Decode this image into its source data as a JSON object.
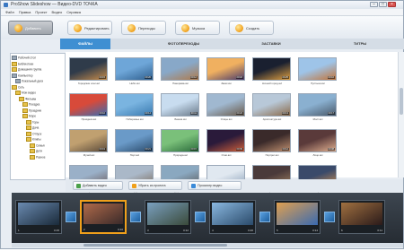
{
  "window": {
    "title": "ProShow Slideshow — Видео-DVD ТОЧКА",
    "min": "–",
    "max": "□",
    "close": "×"
  },
  "menu": [
    "Файл",
    "Правка",
    "Проект",
    "Видео",
    "Справка"
  ],
  "toolbar": [
    {
      "label": "Добавить",
      "active": true
    },
    {
      "label": "Редактировать",
      "active": false
    },
    {
      "label": "Переходы",
      "active": false
    },
    {
      "label": "Музыка",
      "active": false
    },
    {
      "label": "Создать",
      "active": false
    }
  ],
  "tabs": [
    {
      "label": "ФАЙЛЫ",
      "active": true
    },
    {
      "label": "ФОТОПЕРЕХОДЫ",
      "active": false
    },
    {
      "label": "ЗАСТАВКИ",
      "active": false
    },
    {
      "label": "ТИТРЫ",
      "active": false
    }
  ],
  "tree": [
    {
      "label": "Рабочий стол",
      "type": "drive"
    },
    {
      "label": "Библиотеки",
      "type": "folder"
    },
    {
      "label": "Домашняя группа",
      "type": "folder"
    },
    {
      "label": "Компьютер",
      "type": "drive"
    },
    {
      "label": "Локальный диск",
      "type": "drive"
    },
    {
      "label": "Сеть",
      "type": "folder"
    },
    {
      "label": "Мои видео",
      "type": "folder"
    },
    {
      "label": "Фильмы",
      "type": "folder"
    },
    {
      "label": "Поездка",
      "type": "folder"
    },
    {
      "label": "Праздник",
      "type": "folder"
    },
    {
      "label": "Море",
      "type": "folder"
    },
    {
      "label": "Горы",
      "type": "folder"
    },
    {
      "label": "Дача",
      "type": "folder"
    },
    {
      "label": "Отпуск",
      "type": "folder"
    },
    {
      "label": "Клипы",
      "type": "folder"
    },
    {
      "label": "Семья",
      "type": "folder"
    },
    {
      "label": "Дети",
      "type": "folder"
    },
    {
      "label": "Разное",
      "type": "folder"
    }
  ],
  "media": [
    {
      "caption": "Городские огни.avi",
      "dur": "00:15",
      "c1": "#2f3b4a",
      "c2": "#c98d4a"
    },
    {
      "caption": "Небо.avi",
      "dur": "00:20",
      "c1": "#6ea6d8",
      "c2": "#2f5f8e"
    },
    {
      "caption": "Панорама.avi",
      "dur": "00:12",
      "c1": "#88a8c8",
      "c2": "#b07a4a"
    },
    {
      "caption": "Закат.avi",
      "dur": "00:18",
      "c1": "#f0b060",
      "c2": "#4a3a6a"
    },
    {
      "caption": "Ночной город.avi",
      "dur": "00:25",
      "c1": "#1a2030",
      "c2": "#e0a040"
    },
    {
      "caption": "Пустыня.avi",
      "dur": "00:16",
      "c1": "#9ec4e8",
      "c2": "#c2743a"
    },
    {
      "caption": "Праздник.avi",
      "dur": "00:10",
      "c1": "#d84a3a",
      "c2": "#3a6ab0"
    },
    {
      "caption": "Побережье.avi",
      "dur": "00:14",
      "c1": "#7ab4e0",
      "c2": "#3a7ab0"
    },
    {
      "caption": "Башня.avi",
      "dur": "00:11",
      "c1": "#c8dcef",
      "c2": "#6a7a8a"
    },
    {
      "caption": "Улицы.avi",
      "dur": "00:22",
      "c1": "#a0b8d0",
      "c2": "#6a5a4a"
    },
    {
      "caption": "Архитектура.avi",
      "dur": "00:13",
      "c1": "#b8c8d8",
      "c2": "#8a6a4a"
    },
    {
      "caption": "Мост.avi",
      "dur": "00:17",
      "c1": "#8ab0d0",
      "c2": "#4a5a6a"
    },
    {
      "caption": "Музей.avi",
      "dur": "00:19",
      "c1": "#c0a070",
      "c2": "#5a4a3a"
    },
    {
      "caption": "Порт.avi",
      "dur": "00:21",
      "c1": "#6a9ac8",
      "c2": "#2a4a6a"
    },
    {
      "caption": "Природа.avi",
      "dur": "00:15",
      "c1": "#7ac07a",
      "c2": "#2a6a3a"
    },
    {
      "caption": "Огни.avi",
      "dur": "00:09",
      "c1": "#2a1a3a",
      "c2": "#d0603a"
    },
    {
      "caption": "Портрет.avi",
      "dur": "00:12",
      "c1": "#3a2a2a",
      "c2": "#c09070"
    },
    {
      "caption": "Лицо.avi",
      "dur": "00:08",
      "c1": "#5a3a3a",
      "c2": "#e0b090"
    },
    {
      "caption": "Собор.avi",
      "dur": "00:16",
      "c1": "#9ab0c8",
      "c2": "#6a5a5a"
    },
    {
      "caption": "Площадь.avi",
      "dur": "00:14",
      "c1": "#aab8c8",
      "c2": "#7a6a5a"
    },
    {
      "caption": "Дорога.avi",
      "dur": "00:20",
      "c1": "#8aa8c0",
      "c2": "#5a5a5a"
    },
    {
      "caption": "Зима.avi",
      "dur": "00:23",
      "c1": "#e0e8f0",
      "c2": "#8aa0b8"
    },
    {
      "caption": "Горы.avi",
      "dur": "00:17",
      "c1": "#4a3a3a",
      "c2": "#a08060"
    },
    {
      "caption": "Вечер.avi",
      "dur": "00:11",
      "c1": "#3a4a6a",
      "c2": "#d09050"
    }
  ],
  "actions": [
    {
      "label": "Добавить видео",
      "color": "#4aa04a"
    },
    {
      "label": "Убрать из проекта",
      "color": "#f0a01b"
    },
    {
      "label": "Просмотр видео",
      "color": "#3a8ad8"
    }
  ],
  "clips": [
    {
      "num": "1",
      "dur": "0:15",
      "c1": "#6a8ab0",
      "c2": "#1a2a3a",
      "sel": false
    },
    {
      "num": "2",
      "dur": "0:10",
      "c1": "#b06a4a",
      "c2": "#3a2a2a",
      "sel": true
    },
    {
      "num": "3",
      "dur": "0:12",
      "c1": "#7aa0c0",
      "c2": "#3a4a3a",
      "sel": false
    },
    {
      "num": "4",
      "dur": "0:20",
      "c1": "#8ab8e0",
      "c2": "#2a4a6a",
      "sel": false
    },
    {
      "num": "5",
      "dur": "0:14",
      "c1": "#e0a050",
      "c2": "#3a6ab0",
      "sel": false
    },
    {
      "num": "6",
      "dur": "0:11",
      "c1": "#a07040",
      "c2": "#2a1a1a",
      "sel": false
    }
  ]
}
